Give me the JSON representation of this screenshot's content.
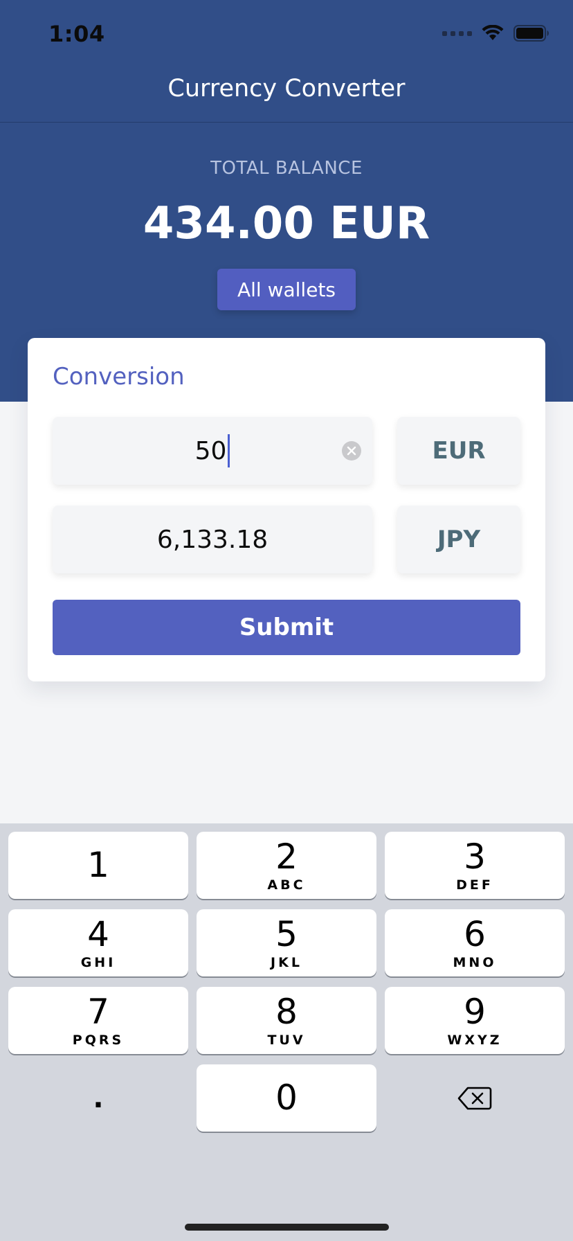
{
  "status_bar": {
    "time": "1:04",
    "signal_icon": "cellular-dots-icon",
    "wifi_icon": "wifi-icon",
    "battery_icon": "battery-full-icon"
  },
  "header": {
    "title": "Currency Converter"
  },
  "balance": {
    "label": "TOTAL BALANCE",
    "amount": "434.00 EUR",
    "wallets_button": "All wallets"
  },
  "conversion": {
    "title": "Conversion",
    "amount_value": "50",
    "from_currency": "EUR",
    "result_value": "6,133.18",
    "to_currency": "JPY",
    "submit_label": "Submit"
  },
  "keyboard": {
    "keys": [
      {
        "digit": "1",
        "letters": ""
      },
      {
        "digit": "2",
        "letters": "ABC"
      },
      {
        "digit": "3",
        "letters": "DEF"
      },
      {
        "digit": "4",
        "letters": "GHI"
      },
      {
        "digit": "5",
        "letters": "JKL"
      },
      {
        "digit": "6",
        "letters": "MNO"
      },
      {
        "digit": "7",
        "letters": "PQRS"
      },
      {
        "digit": "8",
        "letters": "TUV"
      },
      {
        "digit": "9",
        "letters": "WXYZ"
      },
      {
        "digit": "0",
        "letters": ""
      }
    ],
    "decimal_key": ".",
    "delete_icon": "backspace-icon"
  },
  "colors": {
    "header_bg": "#314e88",
    "accent": "#5361bf",
    "currency_text": "#4d6b78",
    "keyboard_bg": "#d3d6dd"
  }
}
